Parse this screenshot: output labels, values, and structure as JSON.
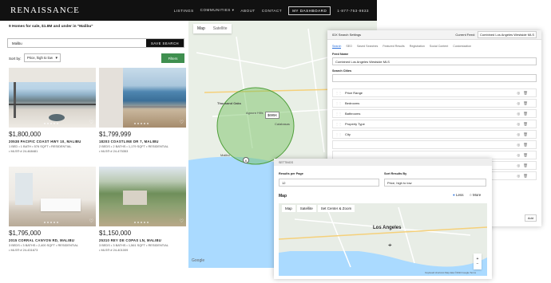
{
  "header": {
    "logo": "RENAISSANCE",
    "nav": [
      "LISTINGS",
      "COMMUNITIES ▾",
      "ABOUT",
      "CONTACT"
    ],
    "dashboard": "MY DASHBOARD",
    "phone": "1-877-753-9833"
  },
  "listings": {
    "results": "9 Homes for sale, $1.8M and under in \"Malibu\"",
    "search_value": "Malibu",
    "search_btn": "SAVE SEARCH",
    "sort_label": "Sort by:",
    "sort_value": "Price, high to low",
    "filters": "Filters",
    "cards": [
      {
        "price": "$1,800,000",
        "address": "20538 PACIFIC COAST HWY 10, MALIBU",
        "details": "1 BED • 1 BATH • 576 SQFT • RESIDENTIAL",
        "mls": "• MLS® # 24-468481"
      },
      {
        "price": "$1,799,999",
        "address": "18203 COASTLINE DR 7, MALIBU",
        "details": "2 BEDS • 2 BATHS • 1,179 SQFT • RESIDENTIAL",
        "mls": "• MLS® # 24-475353"
      },
      {
        "price": "$1,795,000",
        "address": "2015 CORRAL CANYON RD, MALIBU",
        "details": "3 BEDS • 3 BATHS • 2,400 SQFT • RESIDENTIAL",
        "mls": "• MLS® # 24-431673"
      },
      {
        "price": "$1,150,000",
        "address": "25310 REY DE COPAS LN, MALIBU",
        "details": "3 BEDS • 3 BATHS • 1,561 SQFT • RESIDENTIAL",
        "mls": "• MLS® # 24-401009"
      }
    ]
  },
  "map": {
    "tabs": [
      "Map",
      "Satellite"
    ],
    "labels": [
      "Thousand Oaks",
      "Agoura Hills",
      "Malibu",
      "Calabasas"
    ],
    "marker": "$695K",
    "google": "Google"
  },
  "settings": {
    "title": "IDX Search Settings",
    "feed_label": "Current Feed:",
    "feed_value": "Combined Los Angeles Westside MLS",
    "tabs": [
      "Search",
      "SEO",
      "Saved Searches",
      "Featured Results",
      "Registration",
      "Social Content",
      "Customization"
    ],
    "feed_name_label": "Feed Name",
    "feed_name_value": "Combined Los Angeles Westside MLS",
    "search_cities_label": "Search Cities",
    "rows": [
      "Price Range",
      "Bedrooms",
      "Bathrooms",
      "Property Type",
      "City"
    ],
    "add": "Add"
  },
  "settings2": {
    "bar": "SETTINGS",
    "rpp_label": "Results per Page",
    "rpp_value": "12",
    "sort_label": "Sort Results By",
    "sort_value": "Price, high to low",
    "map_label": "Map",
    "less": "Less",
    "more": "More",
    "tabs": [
      "Map",
      "Satellite"
    ],
    "set_center": "Set Center & Zoom",
    "city": "Los Angeles",
    "footer": "Keyboard shortcuts   Map data ©2024 Google   Terms"
  },
  "colors": {
    "header": "#111111",
    "filters": "#3f8f4f",
    "circle": "#6fbf5a",
    "accent": "#2a6fdb"
  }
}
